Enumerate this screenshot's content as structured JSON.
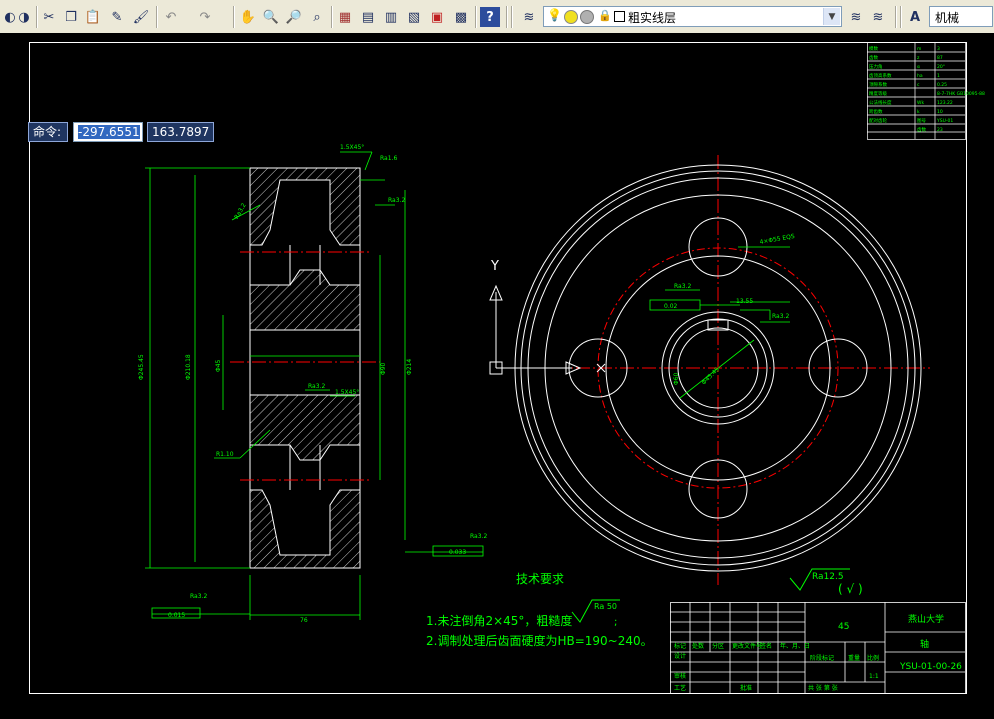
{
  "toolbar": {
    "buttons": [
      "pan-realtime",
      "zoom-realtime",
      "cut",
      "copy",
      "paste",
      "match-properties",
      "brush",
      "undo",
      "redo",
      "pan",
      "zoom-window",
      "zoom-previous",
      "zoom-extents",
      "properties",
      "design-center",
      "tool-palettes",
      "sheet-set",
      "markup",
      "calculator",
      "help"
    ],
    "layer_combo": {
      "value": "粗实线层"
    },
    "style_combo": {
      "value": "机械"
    }
  },
  "command": {
    "label": "命令:",
    "x_value": "-297.6551",
    "y_value": "163.7897"
  },
  "drawing": {
    "tech_title": "技术要求",
    "notes": [
      "1.未注倒角2×45°，粗糙度",
      "2.调制处理后齿面硬度为HB=190~240。"
    ],
    "roughness_note": "Ra 50",
    "note_end": ";",
    "top_roughness": "Ra12.5",
    "top_roughness_paren": "(  √  )",
    "ucs_y": "Y",
    "dims": {
      "chamfer": "1.5X45°",
      "ra_1": "Ra1.6",
      "ra_2": "Ra3.2",
      "ra_3": "Ra3.2",
      "ra_4": "Ra3.2",
      "ra_5": "Ra3.2",
      "ra_6": "Ra3.2",
      "ra_7": "Ra3.2",
      "ra_8": "Ra3.2",
      "tol_left": "0.015",
      "tol_right": "0.033",
      "tol_mid": "0.02",
      "tol_hub": "13.55",
      "radius": "R1.10",
      "chamfer2": "1.5X45°",
      "holes": "4×Φ55 EQS",
      "width_bottom": "76",
      "dia_main": "Φ245.45",
      "dia_2": "Φ210.18",
      "dia_3": "Φ90",
      "dia_4": "Φ45",
      "dia_5": "Φ60",
      "dia_6": "Φ214",
      "dia_7": "Φ45.45"
    },
    "param_table": [
      [
        "模数",
        "m",
        "3"
      ],
      [
        "齿数",
        "z",
        "87"
      ],
      [
        "压力角",
        "α",
        "20°"
      ],
      [
        "齿顶高系数",
        "ha",
        "1"
      ],
      [
        "顶隙系数",
        "c",
        "0.25"
      ],
      [
        "精度等级",
        "",
        "8-7-7HK GB10095-88"
      ],
      [
        "公法线长度",
        "Wk",
        "123.22"
      ],
      [
        "跨齿数",
        "k",
        "10"
      ],
      [
        "配对齿轮",
        "图号",
        "YSU-01"
      ],
      [
        "",
        "齿数",
        "23"
      ]
    ],
    "title_block": {
      "school": "燕山大学",
      "part_name": "轴",
      "material": "45",
      "drawing_no": "YSU-01-00-26",
      "scale": "1:1",
      "row_labels": [
        "标记",
        "处数",
        "分区",
        "更改文件号",
        "签名",
        "年、月、日"
      ],
      "design": "设计",
      "check": "审核",
      "process": "工艺",
      "approve": "批准",
      "stage": "阶段标记",
      "weight": "重量",
      "ratio": "比例",
      "sheets": "共  张  第  张"
    }
  },
  "colors": {
    "canvas": "#000000",
    "outline": "#ffffff",
    "dimension": "#00ff00",
    "centerline": "#ff0000",
    "cmd_bg": "#1f3560"
  }
}
